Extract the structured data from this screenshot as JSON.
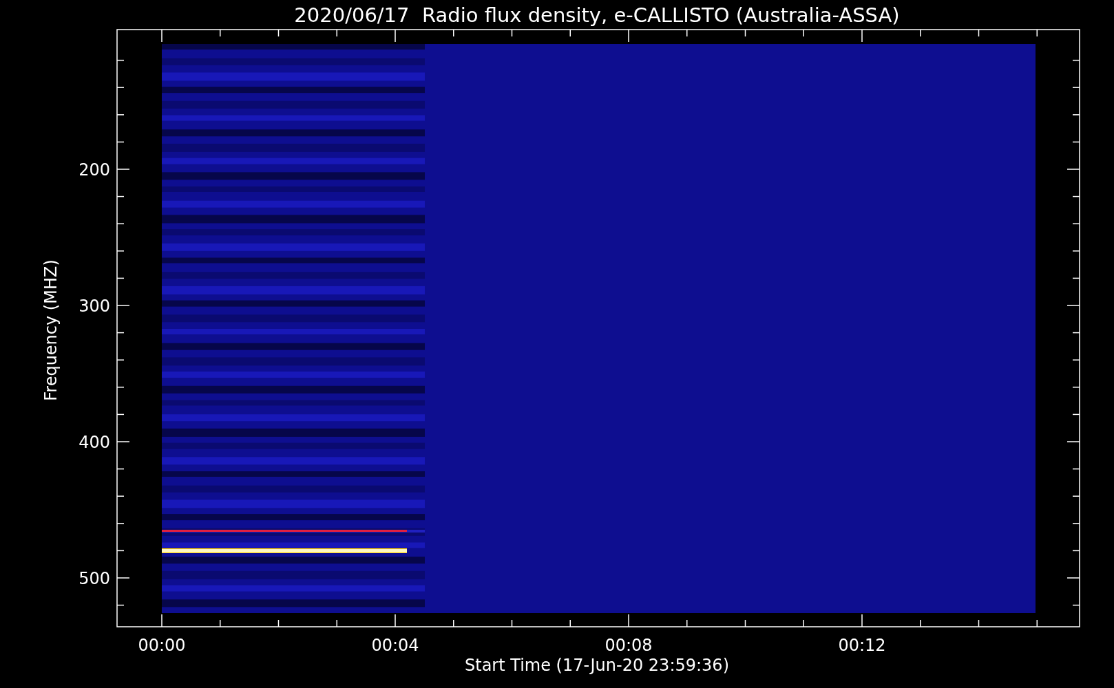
{
  "title": "2020/06/17  Radio flux density, e-CALLISTO (Australia-ASSA)",
  "plot": {
    "ylabel": "Frequency (MHZ)",
    "xlabel": "Start Time (17-Jun-20 23:59:36)",
    "yticks": [
      "200",
      "300",
      "400",
      "500"
    ],
    "xticks": [
      "00:00",
      "00:04",
      "00:08",
      "00:12"
    ]
  }
}
